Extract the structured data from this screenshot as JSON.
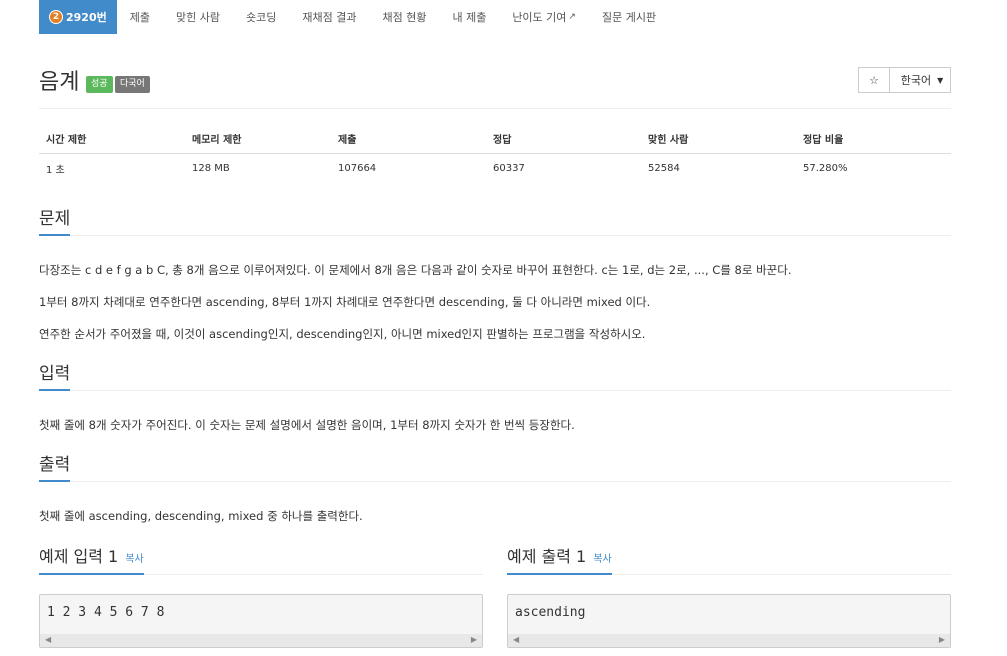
{
  "nav": {
    "active_badge": "2",
    "active_label": "2920번",
    "items": [
      "제출",
      "맞힌 사람",
      "숏코딩",
      "재채점 결과",
      "채점 현황",
      "내 제출",
      "난이도 기여",
      "질문 게시판"
    ],
    "external_icon": "external-link-icon"
  },
  "problem": {
    "title": "음계",
    "label_success": "성공",
    "label_multi": "다국어",
    "star_icon": "☆",
    "language": "한국어"
  },
  "info": {
    "headers": [
      "시간 제한",
      "메모리 제한",
      "제출",
      "정답",
      "맞힌 사람",
      "정답 비율"
    ],
    "values": [
      "1 초",
      "128 MB",
      "107664",
      "60337",
      "52584",
      "57.280%"
    ]
  },
  "sections": {
    "problem_h": "문제",
    "problem_p1": "다장조는 c d e f g a b C, 총 8개 음으로 이루어져있다. 이 문제에서 8개 음은 다음과 같이 숫자로 바꾸어 표현한다. c는 1로, d는 2로, ..., C를 8로 바꾼다.",
    "problem_p2": "1부터 8까지 차례대로 연주한다면 ascending, 8부터 1까지 차례대로 연주한다면 descending, 둘 다 아니라면 mixed 이다.",
    "problem_p3": "연주한 순서가 주어졌을 때, 이것이 ascending인지, descending인지, 아니면 mixed인지 판별하는 프로그램을 작성하시오.",
    "input_h": "입력",
    "input_p": "첫째 줄에 8개 숫자가 주어진다. 이 숫자는 문제 설명에서 설명한 음이며, 1부터 8까지 숫자가 한 번씩 등장한다.",
    "output_h": "출력",
    "output_p": "첫째 줄에 ascending, descending, mixed 중 하나를 출력한다."
  },
  "samples": {
    "input_title": "예제 입력 1",
    "output_title": "예제 출력 1",
    "copy_label": "복사",
    "input_text": "1 2 3 4 5 6 7 8",
    "output_text": "ascending"
  },
  "colors": {
    "primary": "#428bca",
    "success": "#5cb85c",
    "tier_badge": "#e67e22"
  }
}
